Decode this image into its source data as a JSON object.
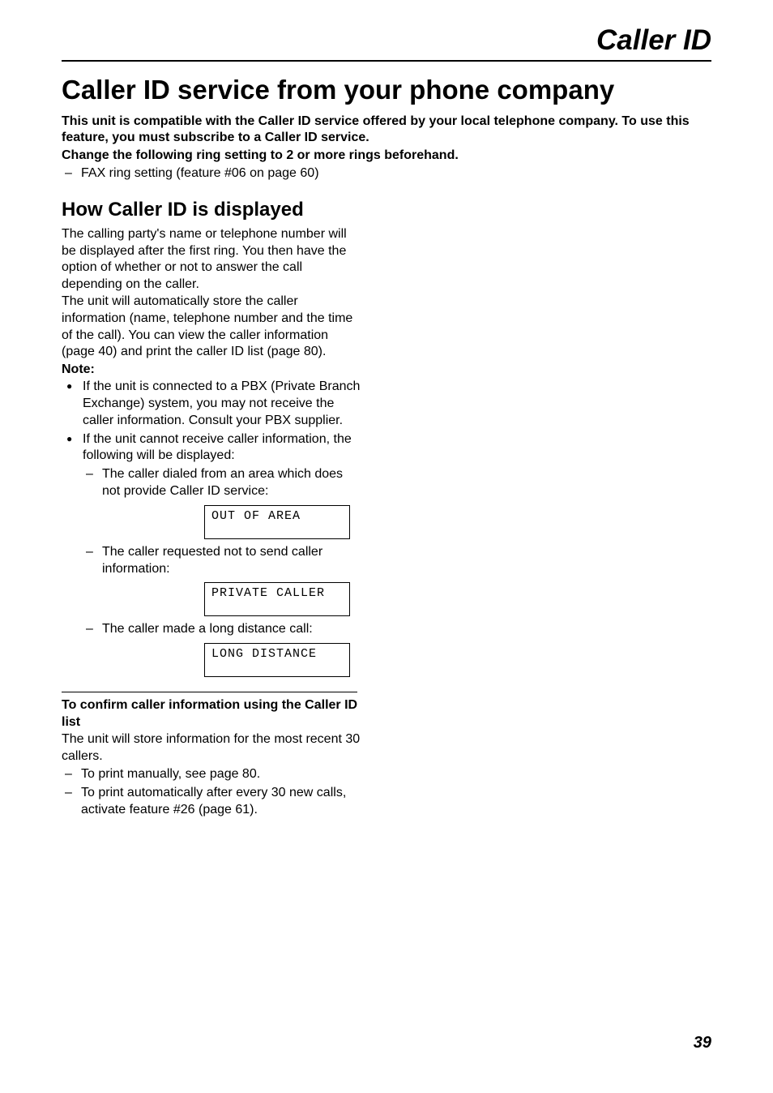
{
  "header": "Caller ID",
  "mainTitle": "Caller ID service from your phone company",
  "introBold1": "This unit is compatible with the Caller ID service offered by your local telephone company. To use this feature, you must subscribe to a Caller ID service.",
  "introBold2": "Change the following ring setting to 2 or more rings beforehand.",
  "introItem": "FAX ring setting (feature #06 on page 60)",
  "h2": "How Caller ID is displayed",
  "para1": "The calling party's name or telephone number will be displayed after the first ring. You then have the option of whether or not to answer the call depending on the caller.",
  "para2": "The unit will automatically store the caller information (name, telephone number and the time of the call). You can view the caller information (page 40) and print the caller ID list (page 80).",
  "noteLabel": "Note:",
  "note1": "If the unit is connected to a PBX (Private Branch Exchange) system, you may not receive the caller information. Consult your PBX supplier.",
  "note2": "If the unit cannot receive caller information, the following will be displayed:",
  "case1": "The caller dialed from an area which does not provide Caller ID service:",
  "lcd1": "OUT OF AREA",
  "case2": "The caller requested not to send caller information:",
  "lcd2": "PRIVATE CALLER",
  "case3": "The caller made a long distance call:",
  "lcd3": "LONG DISTANCE",
  "confirmHead": "To confirm caller information using the Caller ID list",
  "confirmBody": "The unit will store information for the most recent 30 callers.",
  "confirmItem1": "To print manually, see page 80.",
  "confirmItem2": "To print automatically after every 30 new calls, activate feature #26 (page 61).",
  "pageNumber": "39"
}
